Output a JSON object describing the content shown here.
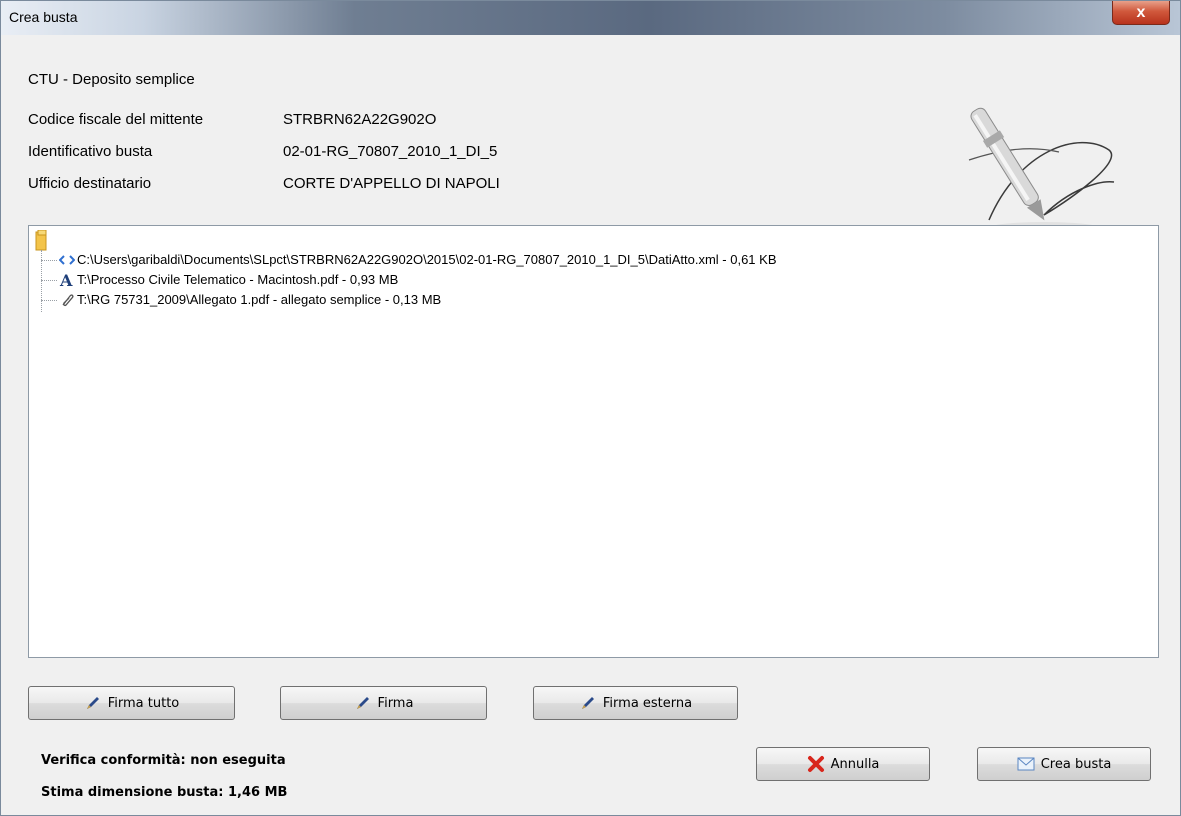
{
  "window": {
    "title": "Crea busta",
    "close_label": "x"
  },
  "heading": "CTU - Deposito semplice",
  "info": [
    {
      "label": "Codice fiscale del mittente",
      "value": "STRBRN62A22G902O"
    },
    {
      "label": "Identificativo busta",
      "value": "02-01-RG_70807_2010_1_DI_5"
    },
    {
      "label": "Ufficio destinatario",
      "value": "CORTE D'APPELLO DI NAPOLI"
    }
  ],
  "tree": {
    "root_icon": "folder-icon",
    "items": [
      {
        "icon": "xml-code-icon",
        "text": "C:\\Users\\garibaldi\\Documents\\SLpct\\STRBRN62A22G902O\\2015\\02-01-RG_70807_2010_1_DI_5\\DatiAtto.xml - 0,61 KB"
      },
      {
        "icon": "document-a-icon",
        "text": "T:\\Processo Civile Telematico - Macintosh.pdf - 0,93 MB"
      },
      {
        "icon": "paperclip-icon",
        "text": "T:\\RG 75731_2009\\Allegato 1.pdf - allegato semplice - 0,13 MB"
      }
    ]
  },
  "buttons": {
    "firma_tutto": "Firma tutto",
    "firma": "Firma",
    "firma_esterna": "Firma esterna",
    "annulla": "Annulla",
    "crea_busta": "Crea busta"
  },
  "status": {
    "verifica": "Verifica conformità: non eseguita",
    "stima": "Stima dimensione busta: 1,46 MB"
  },
  "colors": {
    "accent_blue": "#2f6fd0",
    "cancel_red": "#d8261c",
    "pen_blue": "#2a4a8a"
  }
}
